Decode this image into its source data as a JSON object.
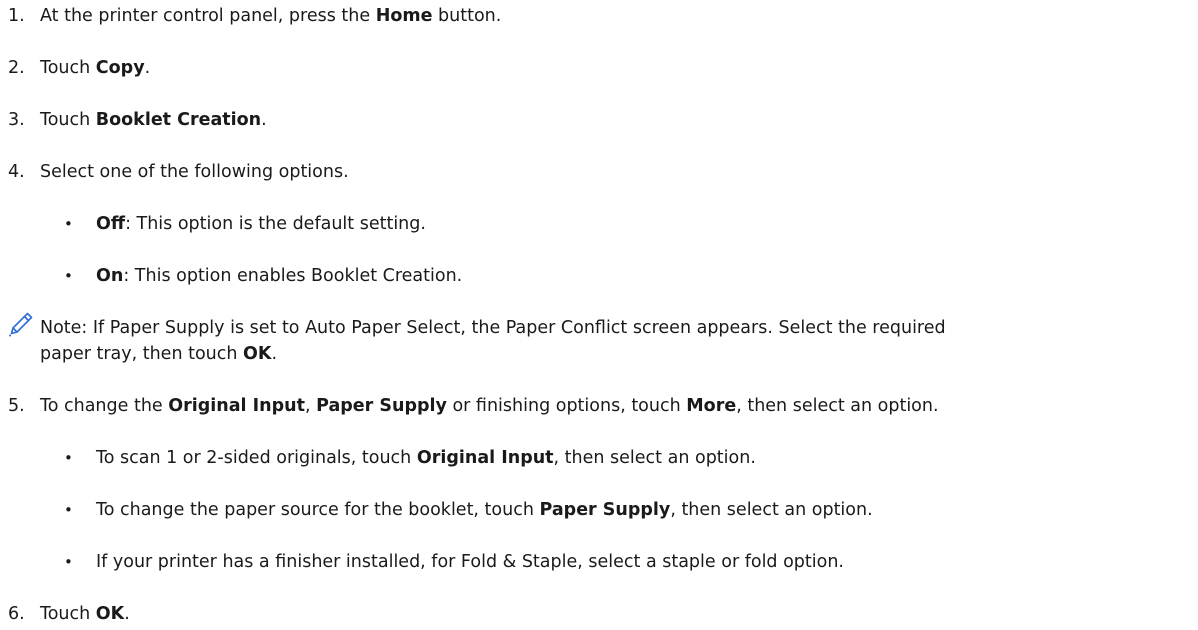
{
  "steps": [
    {
      "num": "1.",
      "pre": "At the printer control panel, press the ",
      "bold": "Home",
      "post": " button."
    },
    {
      "num": "2.",
      "pre": "Touch ",
      "bold": "Copy",
      "post": "."
    },
    {
      "num": "3.",
      "pre": "Touch ",
      "bold": "Booklet Creation",
      "post": "."
    },
    {
      "num": "4.",
      "text": "Select one of the following options."
    },
    {
      "num": "5.",
      "parts": [
        "To change the ",
        "Original Input",
        ", ",
        "Paper Supply",
        " or finishing options, touch ",
        "More",
        ", then select an option."
      ]
    },
    {
      "num": "6.",
      "pre": "Touch ",
      "bold": "OK",
      "post": "."
    }
  ],
  "options": [
    {
      "bold": "Off",
      "post": ": This option is the default setting."
    },
    {
      "bold": "On",
      "post": ": This option enables Booklet Creation."
    }
  ],
  "note": {
    "icon": "pencil-icon",
    "line1": "Note: If Paper Supply is set to Auto Paper Select, the Paper Conflict screen appears. Select the required",
    "line2_pre": "paper tray, then touch ",
    "line2_bold": "OK",
    "line2_post": "."
  },
  "sub_bullets": [
    {
      "pre": "To scan 1 or 2-sided originals, touch ",
      "bold": "Original Input",
      "post": ", then select an option."
    },
    {
      "pre": "To change the paper source for the booklet, touch ",
      "bold": "Paper Supply",
      "post": ", then select an option."
    },
    {
      "text": "If your printer has a finisher installed, for Fold & Staple, select a staple or fold option."
    }
  ],
  "bullet_char": "•",
  "colors": {
    "text": "#1a1a1a",
    "icon": "#2f6fd6"
  }
}
